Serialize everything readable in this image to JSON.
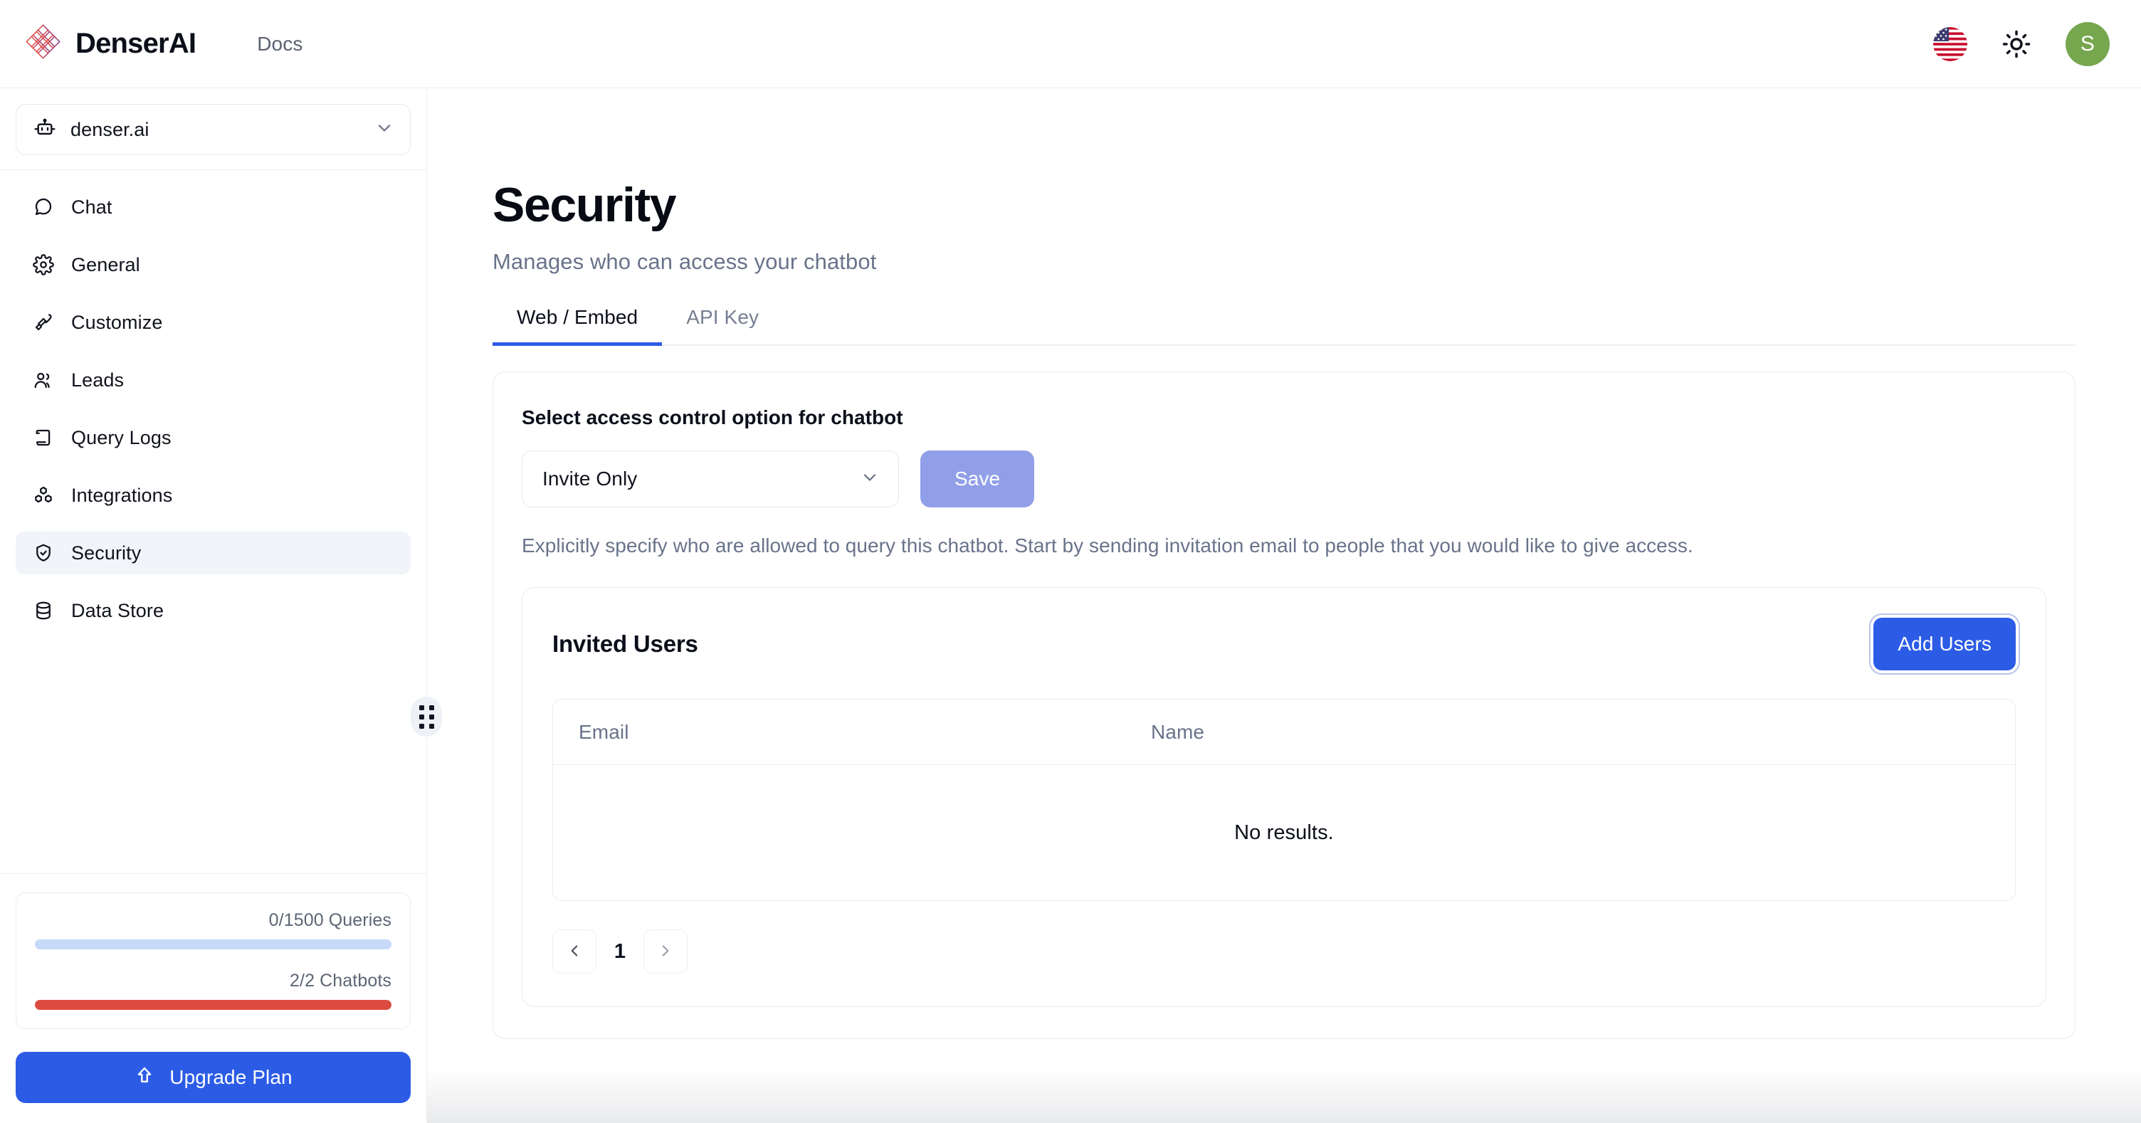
{
  "header": {
    "brand_name": "DenserAI",
    "brand_logo_icon": "denser-diamond-lattice-logo",
    "docs_label": "Docs",
    "language_icon": "us-flag-icon",
    "theme_icon": "sun-icon",
    "avatar_initial": "S",
    "avatar_color": "#76a64e"
  },
  "sidebar": {
    "workspace": {
      "name": "denser.ai",
      "icon": "bot-icon",
      "chevron": "chevron-down-icon"
    },
    "items": [
      {
        "label": "Chat",
        "icon": "chat-bubble-icon",
        "active": false
      },
      {
        "label": "General",
        "icon": "gear-icon",
        "active": false
      },
      {
        "label": "Customize",
        "icon": "paintbrush-icon",
        "active": false
      },
      {
        "label": "Leads",
        "icon": "users-icon",
        "active": false
      },
      {
        "label": "Query Logs",
        "icon": "scroll-icon",
        "active": false
      },
      {
        "label": "Integrations",
        "icon": "blocks-icon",
        "active": false
      },
      {
        "label": "Security",
        "icon": "shield-check-icon",
        "active": true
      },
      {
        "label": "Data Store",
        "icon": "database-icon",
        "active": false
      }
    ],
    "usage": {
      "queries_label": "0/1500 Queries",
      "queries_percent": 0,
      "queries_color": "#c6d9f7",
      "chatbots_label": "2/2 Chatbots",
      "chatbots_percent": 100,
      "chatbots_color": "#db4b40"
    },
    "upgrade_button": {
      "label": "Upgrade Plan",
      "icon": "arrow-up-icon",
      "color": "#2c5ce6"
    },
    "drag_handle_icon": "grip-dots-icon"
  },
  "main": {
    "title": "Security",
    "subtitle": "Manages who can access your chatbot",
    "tabs": [
      {
        "label": "Web / Embed",
        "active": true
      },
      {
        "label": "API Key",
        "active": false
      }
    ],
    "access_control": {
      "label": "Select access control option for chatbot",
      "selected_option": "Invite Only",
      "chevron": "chevron-down-icon",
      "save_label": "Save",
      "save_color": "#919fe8",
      "help_text": "Explicitly specify who are allowed to query this chatbot. Start by sending invitation email to people that you would like to give access."
    },
    "invited_users": {
      "title": "Invited Users",
      "add_button_label": "Add Users",
      "add_button_color": "#2c5ce6",
      "columns": [
        "Email",
        "Name"
      ],
      "rows": [],
      "empty_message": "No results.",
      "pagination": {
        "prev_icon": "chevron-left-icon",
        "next_icon": "chevron-right-icon",
        "current_page": "1"
      }
    }
  }
}
